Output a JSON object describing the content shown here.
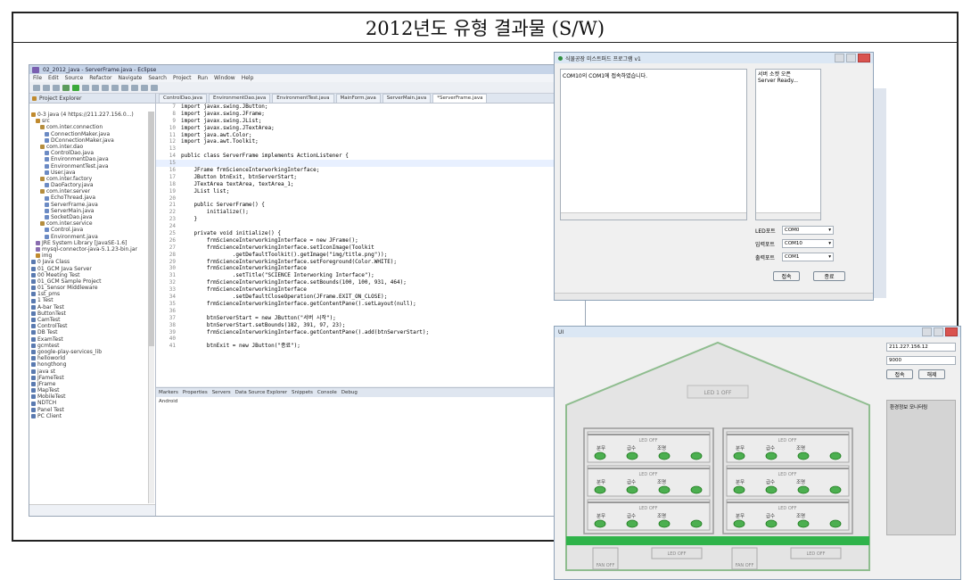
{
  "page": {
    "title": "2012년도 유형 결과물 (S/W)"
  },
  "eclipse": {
    "window_title": "02_2012_java - ServerFrame.java - Eclipse",
    "menu": [
      "File",
      "Edit",
      "Source",
      "Refactor",
      "Navigate",
      "Search",
      "Project",
      "Run",
      "Window",
      "Help"
    ],
    "project_explorer_title": "Project Explorer",
    "tree": [
      {
        "label": "0-3 java (4 https://211.227.156.0...)",
        "color": "#c08a2e"
      },
      {
        "label": "src",
        "color": "#c08a2e"
      },
      {
        "label": "com.inter.connection",
        "color": "#b58d3d"
      },
      {
        "label": "ConnectionMaker.java",
        "color": "#6c8bc4"
      },
      {
        "label": "DConnectionMaker.java",
        "color": "#6c8bc4"
      },
      {
        "label": "com.inter.dao",
        "color": "#b58d3d"
      },
      {
        "label": "ControlDao.java",
        "color": "#6c8bc4"
      },
      {
        "label": "EnvironmentDao.java",
        "color": "#6c8bc4"
      },
      {
        "label": "EnvironmentTest.java",
        "color": "#6c8bc4"
      },
      {
        "label": "User.java",
        "color": "#6c8bc4"
      },
      {
        "label": "com.inter.factory",
        "color": "#b58d3d"
      },
      {
        "label": "DaoFactory.java",
        "color": "#6c8bc4"
      },
      {
        "label": "com.inter.server",
        "color": "#b58d3d"
      },
      {
        "label": "EchoThread.java",
        "color": "#6c8bc4"
      },
      {
        "label": "ServerFrame.java",
        "color": "#6c8bc4"
      },
      {
        "label": "ServerMain.java",
        "color": "#6c8bc4"
      },
      {
        "label": "SocketDao.java",
        "color": "#6c8bc4"
      },
      {
        "label": "com.inter.service",
        "color": "#b58d3d"
      },
      {
        "label": "Control.java",
        "color": "#6c8bc4"
      },
      {
        "label": "Environment.java",
        "color": "#6c8bc4"
      },
      {
        "label": "JRE System Library [JavaSE-1.6]",
        "color": "#8a6db0"
      },
      {
        "label": "mysql-connector-java-5.1.23-bin.jar",
        "color": "#8a6db0"
      },
      {
        "label": "img",
        "color": "#c08a2e"
      },
      {
        "label": "0 Java Class",
        "color": "#5a7ab0"
      },
      {
        "label": "01_GCM Java Server",
        "color": "#5a7ab0"
      },
      {
        "label": "00 Meeting Test",
        "color": "#5a7ab0"
      },
      {
        "label": "01_GCM Sample Project",
        "color": "#5a7ab0"
      },
      {
        "label": "01_Sensor Middleware",
        "color": "#5a7ab0"
      },
      {
        "label": "1st_pms",
        "color": "#5a7ab0"
      },
      {
        "label": "1 Test",
        "color": "#5a7ab0"
      },
      {
        "label": "A-bar Test",
        "color": "#5a7ab0"
      },
      {
        "label": "ButtonTest",
        "color": "#5a7ab0"
      },
      {
        "label": "CamTest",
        "color": "#5a7ab0"
      },
      {
        "label": "ControlTest",
        "color": "#5a7ab0"
      },
      {
        "label": "DB Test",
        "color": "#5a7ab0"
      },
      {
        "label": "ExamTest",
        "color": "#5a7ab0"
      },
      {
        "label": "gcmtest",
        "color": "#5a7ab0"
      },
      {
        "label": "google-play-services_lib",
        "color": "#5a7ab0"
      },
      {
        "label": "helloworld",
        "color": "#5a7ab0"
      },
      {
        "label": "hongthong",
        "color": "#5a7ab0"
      },
      {
        "label": "java st",
        "color": "#5a7ab0"
      },
      {
        "label": "JFameTest",
        "color": "#5a7ab0"
      },
      {
        "label": "JFrame",
        "color": "#5a7ab0"
      },
      {
        "label": "MapTest",
        "color": "#5a7ab0"
      },
      {
        "label": "MobileTest",
        "color": "#5a7ab0"
      },
      {
        "label": "NDTCH",
        "color": "#5a7ab0"
      },
      {
        "label": "Panel Test",
        "color": "#5a7ab0"
      },
      {
        "label": "PC Client",
        "color": "#5a7ab0"
      }
    ],
    "editor_tabs": [
      "ControlDao.java",
      "EnvironmentDao.java",
      "EnvironmentTest.java",
      "MainForm.java",
      "ServerMain.java",
      "*ServerFrame.java"
    ],
    "code_lines": [
      {
        "n": "7",
        "t": "import javax.swing.JButton;"
      },
      {
        "n": "8",
        "t": "import javax.swing.JFrame;"
      },
      {
        "n": "9",
        "t": "import javax.swing.JList;"
      },
      {
        "n": "10",
        "t": "import javax.swing.JTextArea;"
      },
      {
        "n": "11",
        "t": "import java.awt.Color;"
      },
      {
        "n": "12",
        "t": "import java.awt.Toolkit;"
      },
      {
        "n": "13",
        "t": ""
      },
      {
        "n": "14",
        "t": "public class ServerFrame implements ActionListener {"
      },
      {
        "n": "15",
        "t": ""
      },
      {
        "n": "16",
        "t": "    JFrame frmScienceInterworkingInterface;"
      },
      {
        "n": "17",
        "t": "    JButton btnExit, btnServerStart;"
      },
      {
        "n": "18",
        "t": "    JTextArea textArea, textArea_1;"
      },
      {
        "n": "19",
        "t": "    JList list;"
      },
      {
        "n": "20",
        "t": ""
      },
      {
        "n": "21",
        "t": "    public ServerFrame() {"
      },
      {
        "n": "22",
        "t": "        initialize();"
      },
      {
        "n": "23",
        "t": "    }"
      },
      {
        "n": "24",
        "t": ""
      },
      {
        "n": "25",
        "t": "    private void initialize() {"
      },
      {
        "n": "26",
        "t": "        frmScienceInterworkingInterface = new JFrame();"
      },
      {
        "n": "27",
        "t": "        frmScienceInterworkingInterface.setIconImage(Toolkit"
      },
      {
        "n": "28",
        "t": "                .getDefaultToolkit().getImage(\"img/title.png\"));"
      },
      {
        "n": "29",
        "t": "        frmScienceInterworkingInterface.setForeground(Color.WHITE);"
      },
      {
        "n": "30",
        "t": "        frmScienceInterworkingInterface"
      },
      {
        "n": "31",
        "t": "                .setTitle(\"SCIENCE Interworking Interface\");"
      },
      {
        "n": "32",
        "t": "        frmScienceInterworkingInterface.setBounds(100, 100, 931, 464);"
      },
      {
        "n": "33",
        "t": "        frmScienceInterworkingInterface"
      },
      {
        "n": "34",
        "t": "                .setDefaultCloseOperation(JFrame.EXIT_ON_CLOSE);"
      },
      {
        "n": "35",
        "t": "        frmScienceInterworkingInterface.getContentPane().setLayout(null);"
      },
      {
        "n": "36",
        "t": ""
      },
      {
        "n": "37",
        "t": "        btnServerStart = new JButton(\"서버 시작\");"
      },
      {
        "n": "38",
        "t": "        btnServerStart.setBounds(182, 391, 97, 23);"
      },
      {
        "n": "39",
        "t": "        frmScienceInterworkingInterface.getContentPane().add(btnServerStart);"
      },
      {
        "n": "40",
        "t": ""
      },
      {
        "n": "41",
        "t": "        btnExit = new JButton(\"종료\");"
      }
    ],
    "console_tabs": [
      "Markers",
      "Properties",
      "Servers",
      "Data Source Explorer",
      "Snippets",
      "Console",
      "Debug"
    ],
    "console_text": "Android"
  },
  "serial": {
    "title": "식물공장 미스트퍼드 프로그램 v1",
    "log_left": "COM10의 COM1에 접속하였습니다.",
    "log_right": [
      "서버 소켓 오픈",
      "Server Ready..."
    ],
    "ports": [
      {
        "label": "LED포트",
        "value": "COM0"
      },
      {
        "label": "입력포트",
        "value": "COM10"
      },
      {
        "label": "출력포트",
        "value": "COM1"
      }
    ],
    "connect_label": "접속",
    "close_label": "종료"
  },
  "monitor": {
    "title": "UI",
    "top_lamp": "LED 1 OFF",
    "shelves": [
      {
        "label": "LED OFF",
        "plants": [
          "분무",
          "급수",
          "조명"
        ]
      },
      {
        "label": "LED OFF",
        "plants": [
          "분무",
          "급수",
          "조명"
        ]
      },
      {
        "label": "LED OFF",
        "plants": [
          "분무",
          "급수",
          "조명"
        ]
      },
      {
        "label": "LED OFF",
        "plants": [
          "분무",
          "급수",
          "조명"
        ]
      },
      {
        "label": "LED OFF",
        "plants": [
          "분무",
          "급수",
          "조명"
        ]
      },
      {
        "label": "LED OFF",
        "plants": [
          "분무",
          "급수",
          "조명"
        ]
      }
    ],
    "fans": [
      "FAN OFF",
      "FAN OFF"
    ],
    "lamps_bottom": [
      "LED OFF",
      "LED OFF"
    ],
    "ip": "211.227.156.12",
    "port": "9000",
    "connect_label": "접속",
    "close_label": "해제",
    "text_title": "환경정보 모니터링"
  },
  "colors": {
    "accent_green": "#2fb34a",
    "roof_line": "#8fbd8f",
    "highlight": "#e8f0ff"
  }
}
